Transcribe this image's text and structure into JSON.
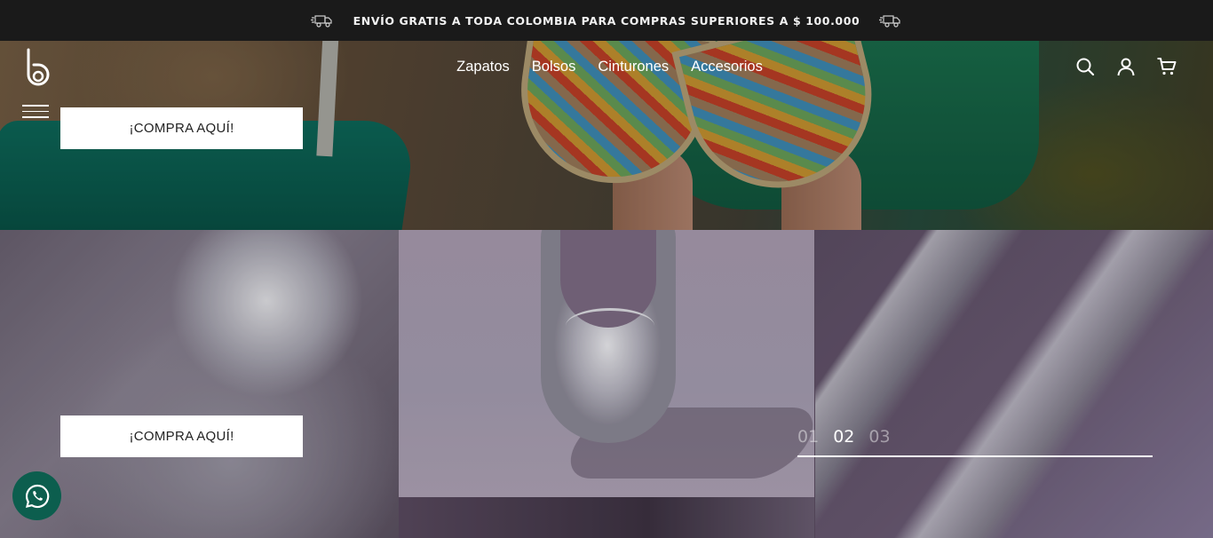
{
  "announcement": {
    "text": "ENVÍO GRATIS A TODA COLOMBIA PARA COMPRAS SUPERIORES A $ 100.000",
    "icon_left": "truck-icon",
    "icon_right": "truck-icon"
  },
  "header": {
    "logo_icon": "brand-logo-b-icon",
    "nav": [
      "Zapatos",
      "Bolsos",
      "Cinturones",
      "Accesorios"
    ],
    "icons": [
      "search-icon",
      "user-icon",
      "cart-icon"
    ],
    "menu_icon": "hamburger-icon"
  },
  "hero": {
    "cta_primary": "¡COMPRA AQUÍ!",
    "cta_secondary": "¡COMPRA AQUÍ!"
  },
  "slider": {
    "pages": [
      "01",
      "02",
      "03"
    ],
    "active_page": "02"
  },
  "floating": {
    "whatsapp_icon": "whatsapp-icon"
  },
  "colors": {
    "topbar_bg": "#1a1a1a",
    "whatsapp_bg": "#0c5e4e",
    "cta_bg": "#ffffff"
  }
}
